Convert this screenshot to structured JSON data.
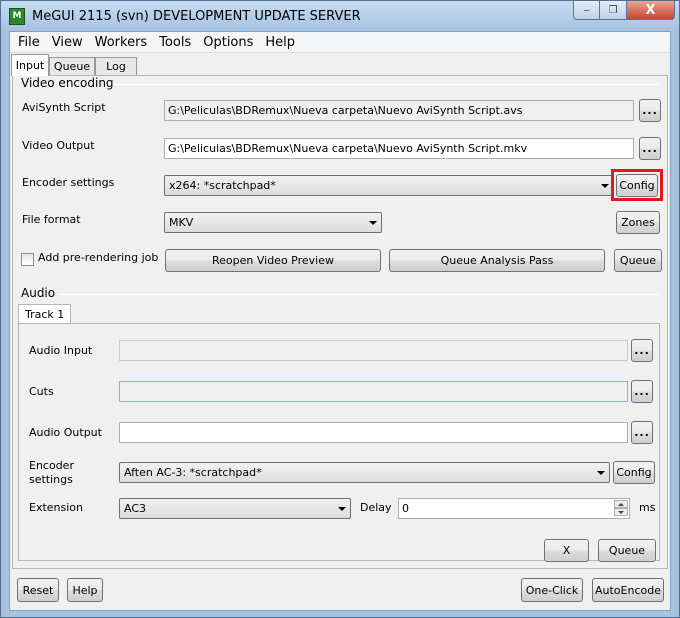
{
  "window": {
    "title": "MeGUI 2115 (svn) DEVELOPMENT UPDATE SERVER",
    "icon_text": "M",
    "minimize_label": "‒",
    "maximize_label": "❐",
    "close_label": "X"
  },
  "menu": {
    "items": [
      {
        "label": "File",
        "mnemonic": "F"
      },
      {
        "label": "View",
        "mnemonic": "V"
      },
      {
        "label": "Workers",
        "mnemonic": ""
      },
      {
        "label": "Tools",
        "mnemonic": "T"
      },
      {
        "label": "Options",
        "mnemonic": "O"
      },
      {
        "label": "Help",
        "mnemonic": "H"
      }
    ]
  },
  "tabs": [
    {
      "label": "Input",
      "active": true
    },
    {
      "label": "Queue",
      "active": false
    },
    {
      "label": "Log",
      "active": false
    }
  ],
  "video": {
    "group_label": "Video encoding",
    "avisynth_label": "AviSynth Script",
    "avisynth_value": "G:\\Peliculas\\BDRemux\\Nueva carpeta\\Nuevo AviSynth Script.avs",
    "output_label": "Video Output",
    "output_value": "G:\\Peliculas\\BDRemux\\Nueva carpeta\\Nuevo AviSynth Script.mkv",
    "encoder_label": "Encoder settings",
    "encoder_value": "x264: *scratchpad*",
    "config_label": "Config",
    "format_label": "File format",
    "format_value": "MKV",
    "zones_label": "Zones",
    "prerender_label": "Add pre-rendering job",
    "reopen_label": "Reopen Video Preview",
    "analysis_label": "Queue Analysis Pass",
    "queue_label": "Queue",
    "browse_label": "..."
  },
  "audio": {
    "group_label": "Audio",
    "track_tab": "Track 1",
    "input_label": "Audio Input",
    "input_value": "",
    "cuts_label": "Cuts",
    "cuts_value": "",
    "output_label": "Audio Output",
    "output_value": "",
    "encoder_label": "Encoder settings",
    "encoder_value": "Aften AC-3: *scratchpad*",
    "config_label": "Config",
    "extension_label": "Extension",
    "extension_value": "AC3",
    "delay_label": "Delay",
    "delay_value": "0",
    "ms_label": "ms",
    "remove_label": "X",
    "queue_label": "Queue",
    "browse_label": "..."
  },
  "footer": {
    "reset_label": "Reset",
    "help_label": "Help",
    "oneclick_label": "One-Click",
    "autoencode_label": "AutoEncode"
  },
  "colors": {
    "highlight": "#e0191f",
    "titlebar": "#a6c2e2"
  }
}
